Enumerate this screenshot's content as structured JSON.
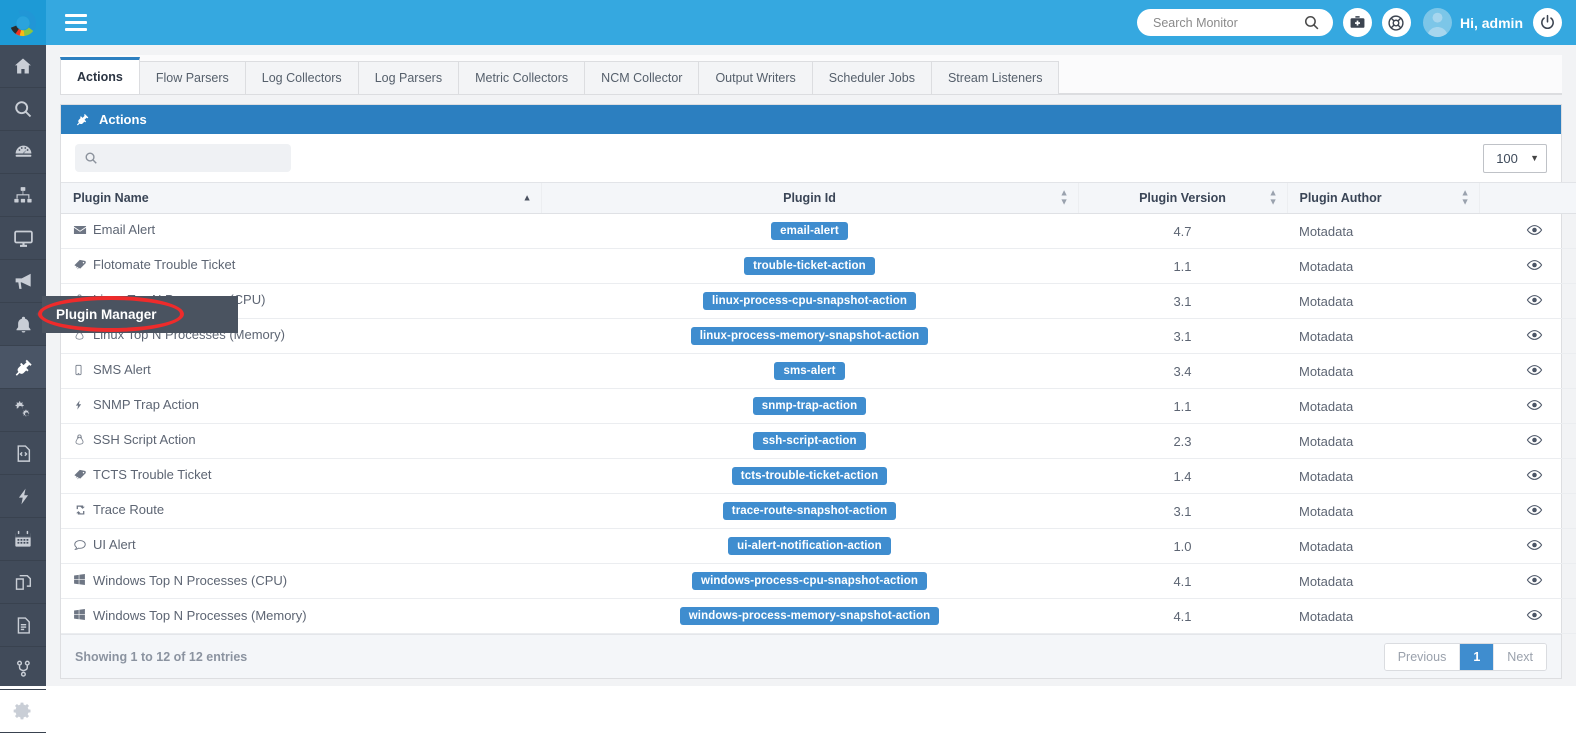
{
  "header": {
    "logo": "motadata-donut-logo",
    "menu_icon": "hamburger-icon",
    "search": {
      "placeholder": "Search Monitor",
      "value": "",
      "icon": "search-icon"
    },
    "buttons": [
      {
        "name": "toolbox-icon",
        "label": ""
      },
      {
        "name": "lifebuoy-icon",
        "label": ""
      }
    ],
    "user": {
      "greeting": "Hi, admin",
      "avatar": "user-avatar"
    },
    "power_icon": "power-icon"
  },
  "sidebar": {
    "items": [
      {
        "name": "home",
        "icon": "home-icon",
        "active": false
      },
      {
        "name": "search",
        "icon": "search-icon",
        "active": false
      },
      {
        "name": "dashboard",
        "icon": "gauge-icon",
        "active": false
      },
      {
        "name": "topology",
        "icon": "sitemap-icon",
        "active": false
      },
      {
        "name": "monitors",
        "icon": "desktop-icon",
        "active": false
      },
      {
        "name": "announcements",
        "icon": "megaphone-icon",
        "active": false
      },
      {
        "name": "alerts",
        "icon": "bell-icon",
        "active": false
      },
      {
        "name": "plugin-manager",
        "icon": "plug-icon",
        "active": true
      },
      {
        "name": "settings-gears",
        "icon": "gears-icon",
        "active": false
      },
      {
        "name": "code",
        "icon": "code-file-icon",
        "active": false
      },
      {
        "name": "events",
        "icon": "bolt-icon",
        "active": false
      },
      {
        "name": "scheduler",
        "icon": "calendar-icon",
        "active": false
      },
      {
        "name": "layers",
        "icon": "copy-layers-icon",
        "active": false
      },
      {
        "name": "reports",
        "icon": "document-icon",
        "active": false
      },
      {
        "name": "workflow",
        "icon": "branch-icon",
        "active": false
      },
      {
        "name": "configuration",
        "icon": "gear-icon",
        "active": false
      }
    ]
  },
  "tabs": [
    {
      "label": "Actions",
      "active": true
    },
    {
      "label": "Flow Parsers",
      "active": false
    },
    {
      "label": "Log Collectors",
      "active": false
    },
    {
      "label": "Log Parsers",
      "active": false
    },
    {
      "label": "Metric Collectors",
      "active": false
    },
    {
      "label": "NCM Collector",
      "active": false
    },
    {
      "label": "Output Writers",
      "active": false
    },
    {
      "label": "Scheduler Jobs",
      "active": false
    },
    {
      "label": "Stream Listeners",
      "active": false
    }
  ],
  "panel": {
    "title": "Actions",
    "icon": "plug-icon",
    "search": {
      "placeholder": "",
      "value": "",
      "icon": "search-icon"
    },
    "page_length": {
      "value": "100",
      "caret": "chevron-down-icon"
    }
  },
  "table": {
    "columns": [
      {
        "label": "Plugin Name",
        "sort": "asc"
      },
      {
        "label": "Plugin Id",
        "sort": "none"
      },
      {
        "label": "Plugin Version",
        "sort": "none"
      },
      {
        "label": "Plugin Author",
        "sort": "none"
      },
      {
        "label": "",
        "sort": ""
      }
    ],
    "rows": [
      {
        "icon": "envelope-icon",
        "name": "Email Alert",
        "id": "email-alert",
        "version": "4.7",
        "author": "Motadata",
        "action": "eye-icon"
      },
      {
        "icon": "tags-icon",
        "name": "Flotomate Trouble Ticket",
        "id": "trouble-ticket-action",
        "version": "1.1",
        "author": "Motadata",
        "action": "eye-icon"
      },
      {
        "icon": "linux-icon",
        "name": "Linux Top N Processes (CPU)",
        "id": "linux-process-cpu-snapshot-action",
        "version": "3.1",
        "author": "Motadata",
        "action": "eye-icon"
      },
      {
        "icon": "linux-icon",
        "name": "Linux Top N Processes (Memory)",
        "id": "linux-process-memory-snapshot-action",
        "version": "3.1",
        "author": "Motadata",
        "action": "eye-icon"
      },
      {
        "icon": "mobile-icon",
        "name": "SMS Alert",
        "id": "sms-alert",
        "version": "3.4",
        "author": "Motadata",
        "action": "eye-icon"
      },
      {
        "icon": "bolt-icon",
        "name": "SNMP Trap Action",
        "id": "snmp-trap-action",
        "version": "1.1",
        "author": "Motadata",
        "action": "eye-icon"
      },
      {
        "icon": "linux-icon",
        "name": "SSH Script Action",
        "id": "ssh-script-action",
        "version": "2.3",
        "author": "Motadata",
        "action": "eye-icon"
      },
      {
        "icon": "tags-icon",
        "name": "TCTS Trouble Ticket",
        "id": "tcts-trouble-ticket-action",
        "version": "1.4",
        "author": "Motadata",
        "action": "eye-icon"
      },
      {
        "icon": "retweet-icon",
        "name": "Trace Route",
        "id": "trace-route-snapshot-action",
        "version": "3.1",
        "author": "Motadata",
        "action": "eye-icon"
      },
      {
        "icon": "comment-icon",
        "name": "UI Alert",
        "id": "ui-alert-notification-action",
        "version": "1.0",
        "author": "Motadata",
        "action": "eye-icon"
      },
      {
        "icon": "windows-icon",
        "name": "Windows Top N Processes (CPU)",
        "id": "windows-process-cpu-snapshot-action",
        "version": "4.1",
        "author": "Motadata",
        "action": "eye-icon"
      },
      {
        "icon": "windows-icon",
        "name": "Windows Top N Processes (Memory)",
        "id": "windows-process-memory-snapshot-action",
        "version": "4.1",
        "author": "Motadata",
        "action": "eye-icon"
      }
    ]
  },
  "footer": {
    "info": "Showing 1 to 12 of 12 entries",
    "pagination": {
      "previous": "Previous",
      "pages": [
        "1"
      ],
      "next": "Next",
      "active_page": "1"
    }
  },
  "tooltip": {
    "text": "Plugin Manager"
  },
  "colors": {
    "topbar": "#35a8e0",
    "sidebar": "#414b5a",
    "panel_header": "#2c7fc0",
    "badge": "#3f8dcf",
    "annotation": "#ee2b2b",
    "tooltip_bg": "#4a5360"
  }
}
